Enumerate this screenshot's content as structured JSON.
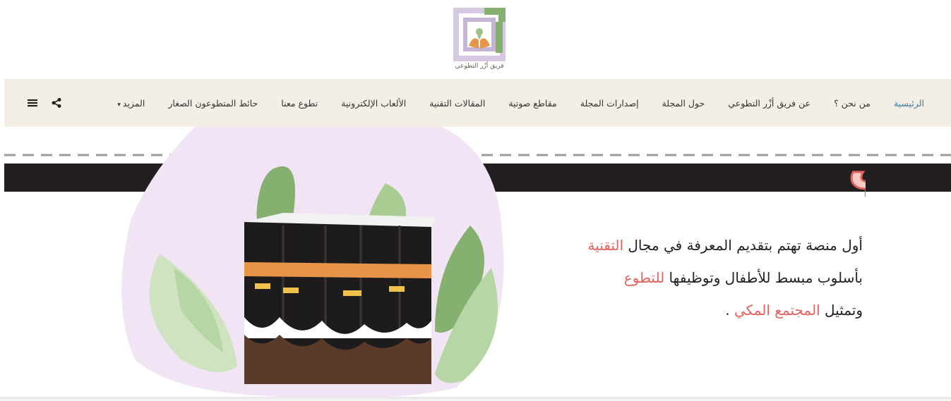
{
  "logo": {
    "caption": "فريق أزْر التطوعي",
    "colors": {
      "purple": "#b8a2c8",
      "green": "#7faa6c",
      "orange": "#e8954a"
    }
  },
  "nav": {
    "items": [
      {
        "label": "الرئيسية",
        "active": true
      },
      {
        "label": "من نحن ؟"
      },
      {
        "label": "عن فريق أزْر التطوعي"
      },
      {
        "label": "حول المجلة"
      },
      {
        "label": "إصدارات المجلة"
      },
      {
        "label": "مقاطع صوتية"
      },
      {
        "label": "المقالات التقنية"
      },
      {
        "label": "الألعاب الإلكترونية"
      },
      {
        "label": "تطوع معنا"
      },
      {
        "label": "حائط المتطوعون الصغار"
      },
      {
        "label": "المزيد",
        "caret": "▾"
      }
    ],
    "icons": [
      "share-icon",
      "menu-icon"
    ],
    "colors": {
      "bar": "#f4efe6",
      "active": "#3a7ca5"
    }
  },
  "hero": {
    "title": "ضياء مكي",
    "lines": [
      {
        "pre": "أول منصة تهتم بتقديم المعرفة في مجال ",
        "hl": "التقنية",
        "post": ""
      },
      {
        "pre": "بأسلوب مبسط للأطفال وتوظيفها ",
        "hl": "للتطوع",
        "post": ""
      },
      {
        "pre": "وتمثيل ",
        "hl": "المجتمع المكي",
        "post": " ."
      }
    ],
    "colors": {
      "highlight": "#e8615a",
      "title_fill": "#f7c9c4",
      "title_stroke": "#e0625a",
      "band": "#231f20",
      "blob": "#f1e4f5"
    }
  }
}
